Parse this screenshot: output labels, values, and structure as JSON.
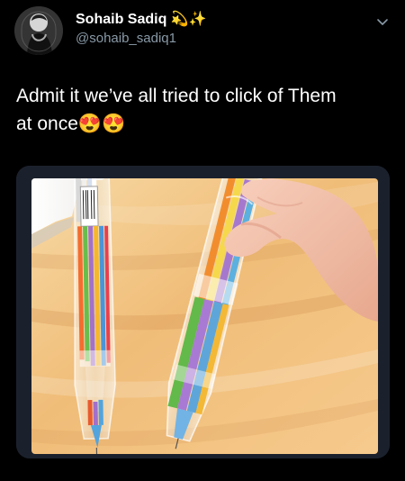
{
  "tweet": {
    "author_name": "Sohaib Sadiq",
    "author_badge": "💫✨",
    "author_handle": "@sohaib_sadiq1",
    "text_line_1": "Admit it we’ve all tried to click of Them",
    "text_line_2": "at once",
    "text_emojis": "😍😍"
  },
  "icons": {
    "menu": "chevron-down-icon",
    "avatar": "avatar",
    "image": "pens-photo"
  },
  "colors": {
    "background": "#000000",
    "text_primary": "#ffffff",
    "text_secondary": "#8899a6",
    "wood": "#f2c486",
    "pen_blue": "#5ea6d9",
    "pen_green": "#63b94a",
    "pen_purple": "#9d74c6",
    "pen_orange": "#f18f35"
  }
}
